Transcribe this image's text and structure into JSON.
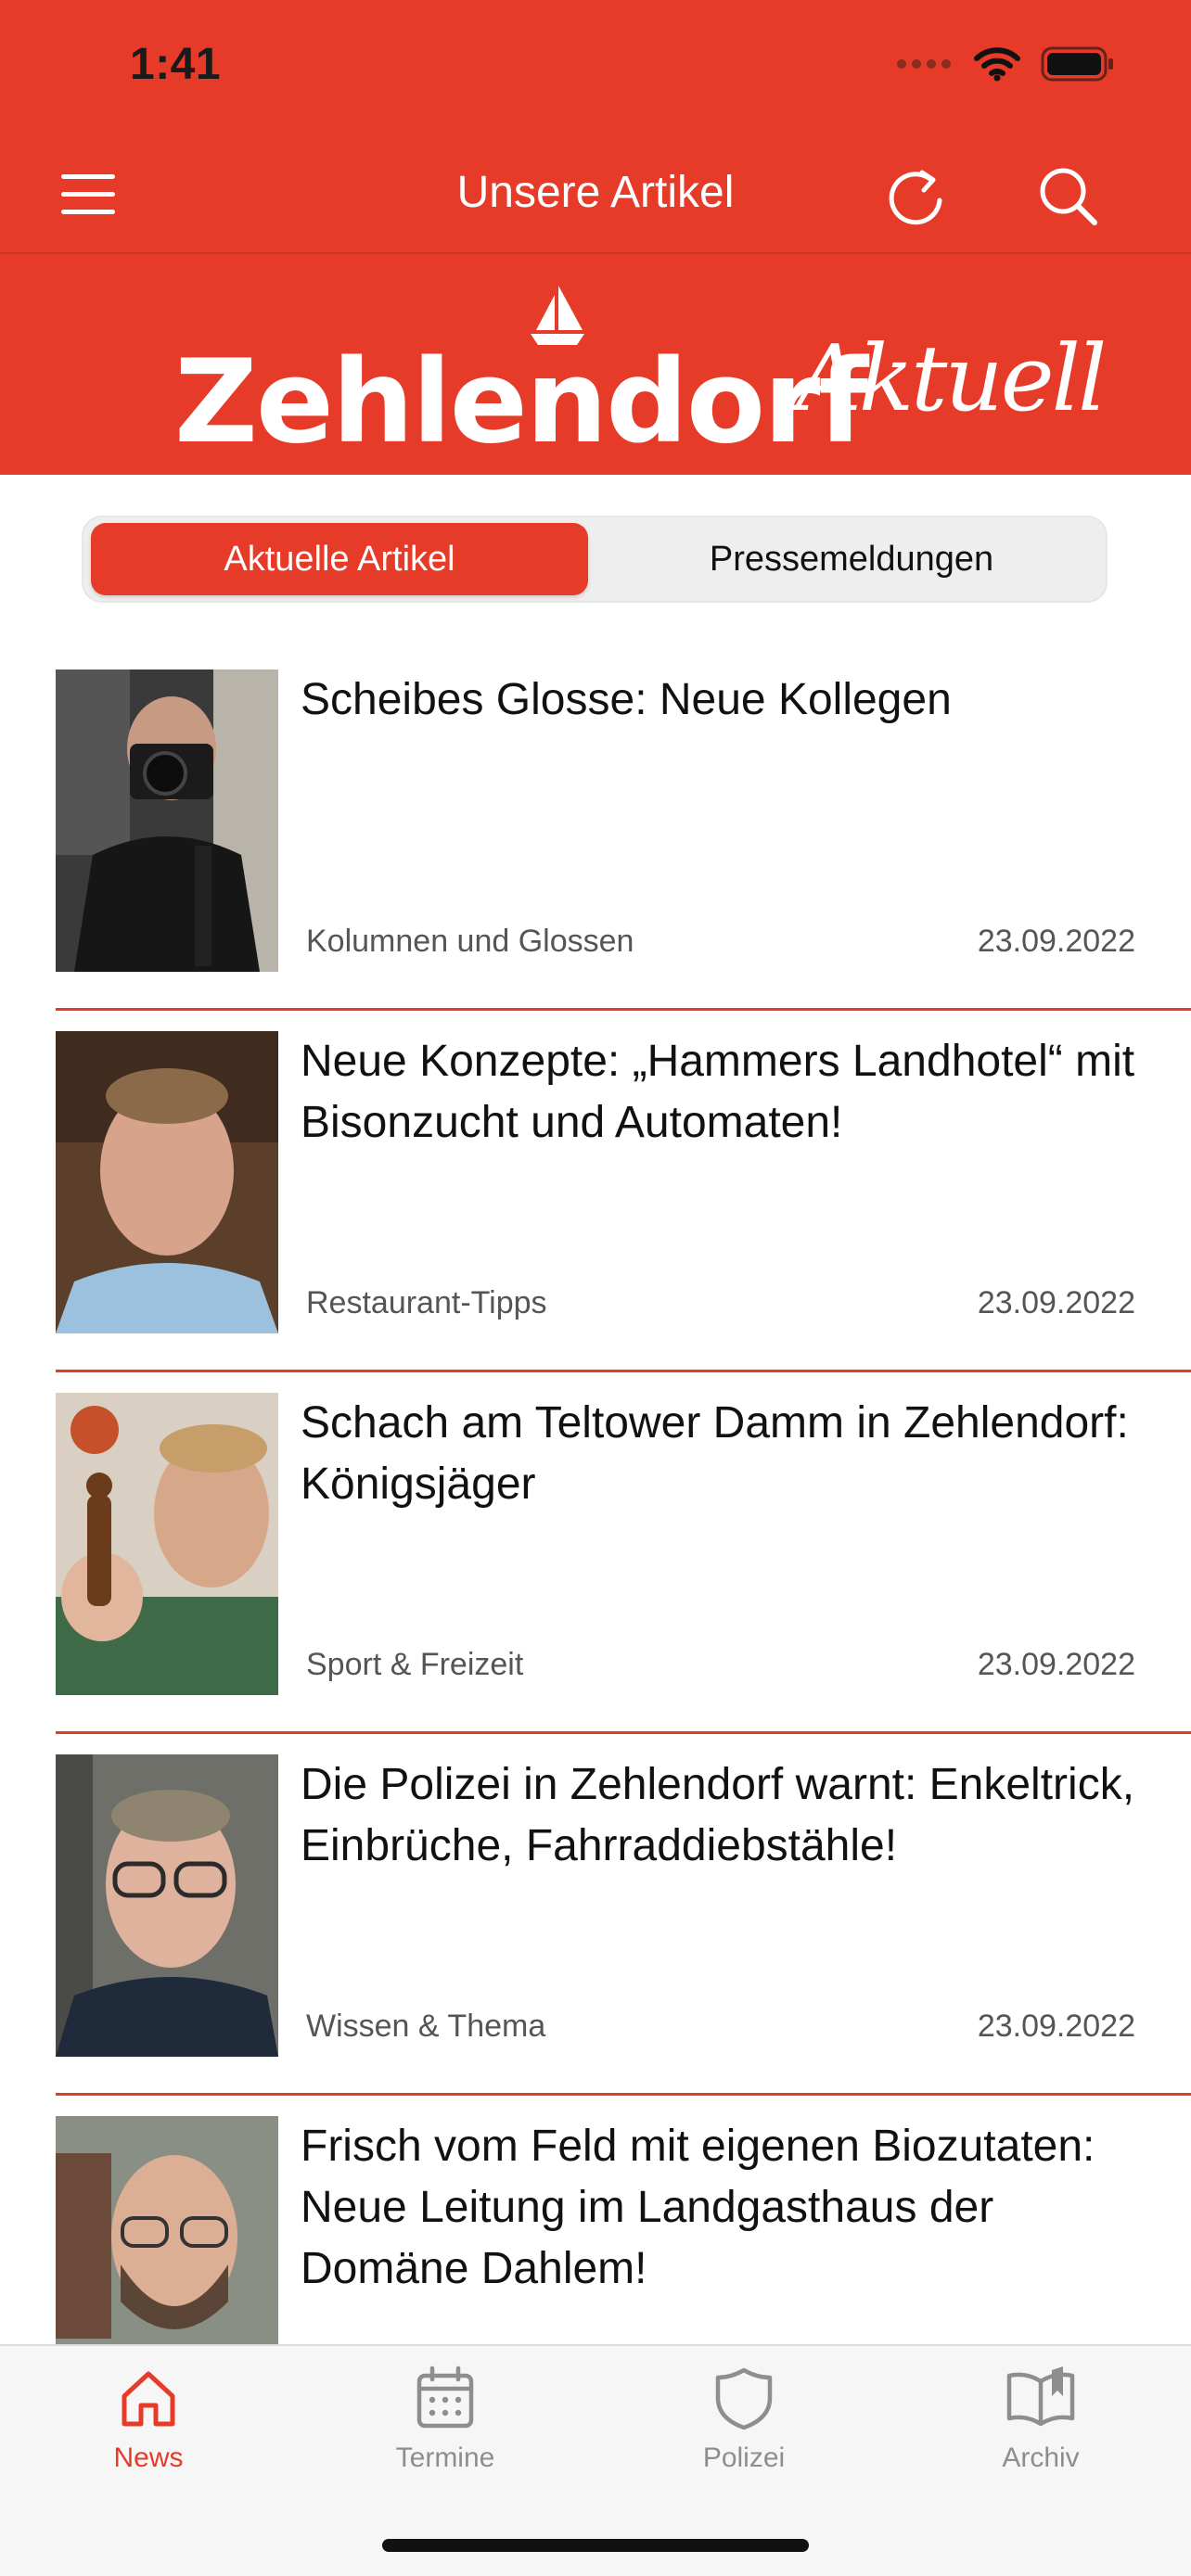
{
  "status": {
    "time": "1:41"
  },
  "nav": {
    "title": "Unsere Artikel"
  },
  "brand": {
    "main": "Zehlendorf",
    "script": "Aktuell"
  },
  "tabs_top": {
    "active": "Aktuelle Artikel",
    "inactive": "Pressemeldungen"
  },
  "articles": [
    {
      "title": "Scheibes Glosse: Neue Kollegen",
      "category": "Kolumnen und Glossen",
      "date": "23.09.2022"
    },
    {
      "title": "Neue Konzepte: „Hammers Landhotel“ mit Bisonzucht und Automaten!",
      "category": "Restaurant-Tipps",
      "date": "23.09.2022"
    },
    {
      "title": "Schach am Teltower Damm in Zehlendorf: Königsjäger",
      "category": "Sport & Freizeit",
      "date": "23.09.2022"
    },
    {
      "title": "Die Polizei in Zehlendorf warnt: Enkeltrick, Einbrüche, Fahrraddiebstähle!",
      "category": "Wissen & Thema",
      "date": "23.09.2022"
    },
    {
      "title": "Frisch vom Feld mit eigenen Biozutaten: Neue Leitung  im Landgasthaus der Domäne Dahlem!",
      "category": "",
      "date": ""
    }
  ],
  "tabbar": [
    {
      "label": "News",
      "icon": "home-icon"
    },
    {
      "label": "Termine",
      "icon": "calendar-icon"
    },
    {
      "label": "Polizei",
      "icon": "shield-icon"
    },
    {
      "label": "Archiv",
      "icon": "book-icon"
    }
  ],
  "colors": {
    "brand": "#e63b29",
    "tab_inactive": "#8e8e8e"
  }
}
